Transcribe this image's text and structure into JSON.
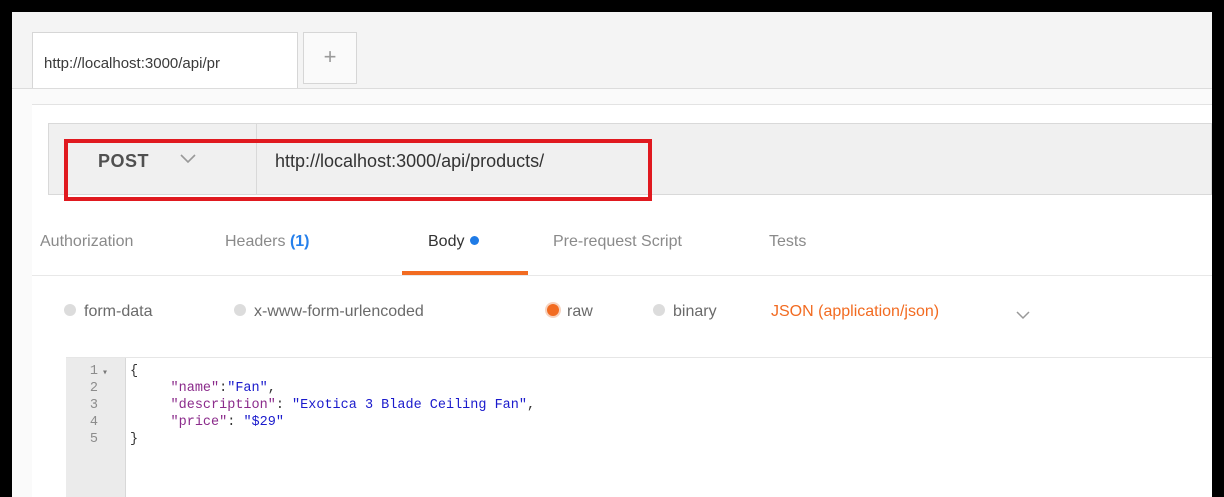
{
  "tabs": {
    "active_label": "http://localhost:3000/api/pr",
    "add_label": "+"
  },
  "request": {
    "method": "POST",
    "url": "http://localhost:3000/api/products/"
  },
  "request_tabs": [
    {
      "label": "Authorization"
    },
    {
      "label": "Headers",
      "count": "(1)"
    },
    {
      "label": "Body"
    },
    {
      "label": "Pre-request Script"
    },
    {
      "label": "Tests"
    }
  ],
  "body_options": {
    "form_data": "form-data",
    "urlencoded": "x-www-form-urlencoded",
    "raw": "raw",
    "binary": "binary",
    "content_type": "JSON (application/json)",
    "selected": "raw"
  },
  "editor": {
    "lines": [
      {
        "no": "1",
        "text": "{"
      },
      {
        "no": "2",
        "key": "\"name\"",
        "sep": ":",
        "value": "\"Fan\"",
        "tail": ","
      },
      {
        "no": "3",
        "key": "\"description\"",
        "sep": ": ",
        "value": "\"Exotica 3 Blade Ceiling Fan\"",
        "tail": ","
      },
      {
        "no": "4",
        "key": "\"price\"",
        "sep": ": ",
        "value": "\"$29\"",
        "tail": ""
      },
      {
        "no": "5",
        "text": "}"
      }
    ]
  },
  "colors": {
    "accent": "#f26b21",
    "highlight_box": "#e0191f",
    "link_blue": "#2680eb"
  }
}
